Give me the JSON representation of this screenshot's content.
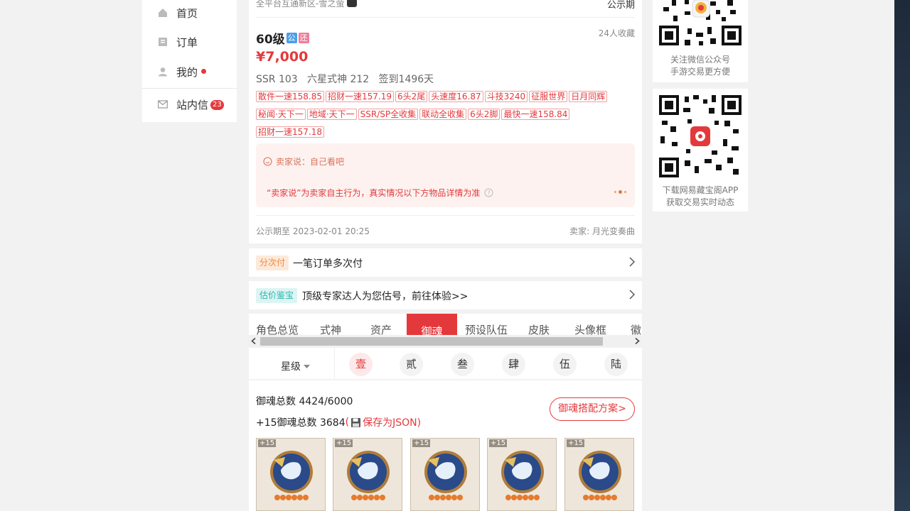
{
  "nav": {
    "items": [
      {
        "label": "首页",
        "icon": "home-icon"
      },
      {
        "label": "订单",
        "icon": "order-icon"
      },
      {
        "label": "我的",
        "icon": "user-icon"
      },
      {
        "label": "站内信",
        "icon": "mail-icon",
        "badge": "23"
      }
    ]
  },
  "listing": {
    "server": "全平台互通新区-雪之萤",
    "status": "公示期",
    "level": "60级",
    "tag_gong": "公",
    "tag_huan": "还",
    "favorites": "24人收藏",
    "price": "¥7,000",
    "summary": "SSR 103   六星式神 212   签到1496天",
    "tags": [
      "散件一速158.85",
      "招财一速157.19",
      "6头2尾",
      "头速度16.87",
      "斗技3240",
      "征服世界",
      "日月同辉",
      "秘闻·天下一",
      "地域·天下一",
      "SSR/SP全收集",
      "联动全收集",
      "6头2脚",
      "最快一速158.84",
      "招财一速157.18"
    ],
    "seller_says": "卖家说：自己看吧",
    "disclaimer": "“卖家说”为卖家自主行为，真实情况以下方物品详情为准",
    "publicity_until": "公示期至 2023-02-01 20:25",
    "seller": "卖家: 月光变奏曲"
  },
  "installment": {
    "pill": "分次付",
    "text": "一笔订单多次付"
  },
  "appraisal": {
    "pill": "估价鉴宝",
    "text": "顶级专家达人为您估号，前往体验>>"
  },
  "tabs": [
    "角色总览",
    "式神",
    "资产",
    "御魂",
    "预设队伍",
    "皮肤",
    "头像框",
    "徽"
  ],
  "active_tab": "御魂",
  "star_filter": "星级",
  "levels": [
    "壹",
    "贰",
    "叁",
    "肆",
    "伍",
    "陆"
  ],
  "active_level": "壹",
  "soul": {
    "total": "御魂总数 4424/6000",
    "plus15_prefix": "+15御魂总数 3684",
    "save_json": "保存为JSON)",
    "save_paren": "(",
    "plan_button": "御魂搭配方案>",
    "items": [
      "+15",
      "+15",
      "+15",
      "+15",
      "+15"
    ]
  },
  "qr": {
    "wechat_caption_1": "关注微信公众号",
    "wechat_caption_2": "手游交易更方便",
    "app_caption_1": "下载网易藏宝阁APP",
    "app_caption_2": "获取交易实时动态"
  },
  "colors": {
    "accent": "#e4393c",
    "price": "#e4393c",
    "teal": "#2ab7b0",
    "orange": "#f0883a"
  }
}
